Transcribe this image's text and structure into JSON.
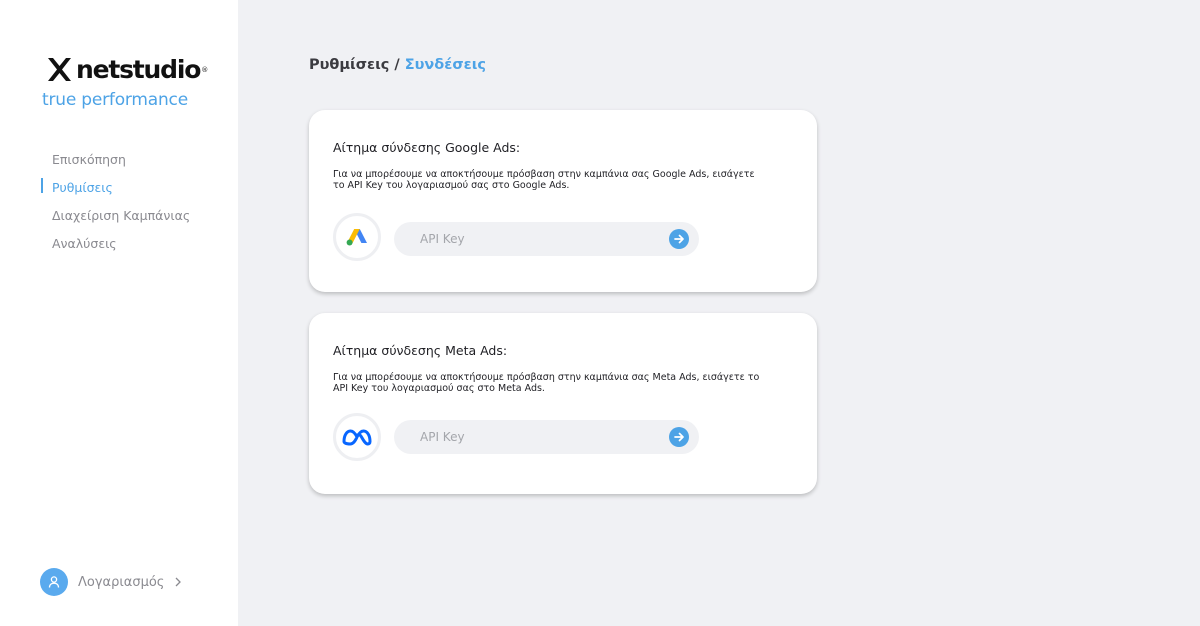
{
  "brand": {
    "name": "netstudio",
    "registered": "®",
    "tagline": "true performance",
    "accent_color": "#4da3e6"
  },
  "sidebar": {
    "items": [
      {
        "label": "Επισκόπηση",
        "active": false
      },
      {
        "label": "Ρυθμίσεις",
        "active": true
      },
      {
        "label": "Διαχείριση Καμπάνιας",
        "active": false
      },
      {
        "label": "Αναλύσεις",
        "active": false
      }
    ],
    "account": {
      "label": "Λογαριασμός",
      "icon": "user-icon"
    }
  },
  "breadcrumb": {
    "parent": "Ρυθμίσεις",
    "separator": " / ",
    "current": "Συνδέσεις"
  },
  "cards": {
    "google": {
      "title": "Αίτημα σύνδεσης Google Ads:",
      "description": "Για να μπορέσουμε να αποκτήσουμε πρόσβαση στην καμπάνια σας Google Ads, εισάγετε το API Key του λογαριασμού σας στο Google Ads.",
      "icon": "google-ads-icon",
      "input_placeholder": "API Key",
      "input_value": ""
    },
    "meta": {
      "title": "Αίτημα σύνδεσης Meta Ads:",
      "description": "Για να μπορέσουμε να αποκτήσουμε πρόσβαση στην καμπάνια σας Meta Ads, εισάγετε το API Key του λογαριασμού σας στο Meta Ads.",
      "icon": "meta-icon",
      "input_placeholder": "API Key",
      "input_value": ""
    }
  }
}
